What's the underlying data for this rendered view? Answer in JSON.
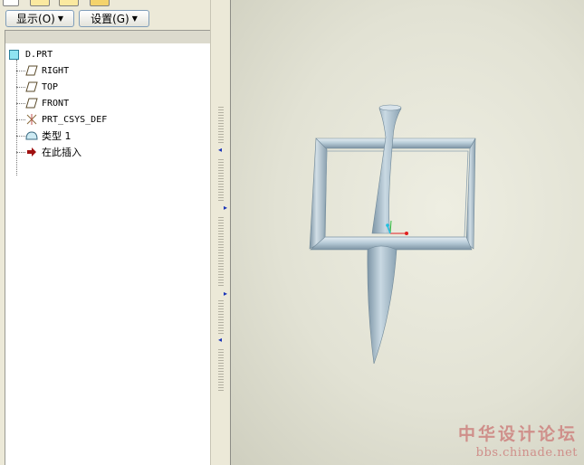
{
  "toolbar": {
    "display_label": "显示(O)",
    "settings_label": "设置(G)"
  },
  "model_tree": {
    "root": "D.PRT",
    "items": [
      {
        "label": "RIGHT",
        "icon": "datum-plane-icon"
      },
      {
        "label": "TOP",
        "icon": "datum-plane-icon"
      },
      {
        "label": "FRONT",
        "icon": "datum-plane-icon"
      },
      {
        "label": "PRT_CSYS_DEF",
        "icon": "coordinate-system-icon"
      },
      {
        "label": "类型 1",
        "icon": "feature-icon"
      },
      {
        "label": "在此插入",
        "icon": "insert-here-arrow-icon"
      }
    ]
  },
  "watermark": {
    "text": "中华设计论坛",
    "url": "bbs.chinade.net"
  },
  "colors": {
    "model_fill": "#b8ccd8",
    "insert_arrow": "#a01010",
    "splitter_arrow": "#1a34b8",
    "watermark": "#cf8f8a"
  }
}
